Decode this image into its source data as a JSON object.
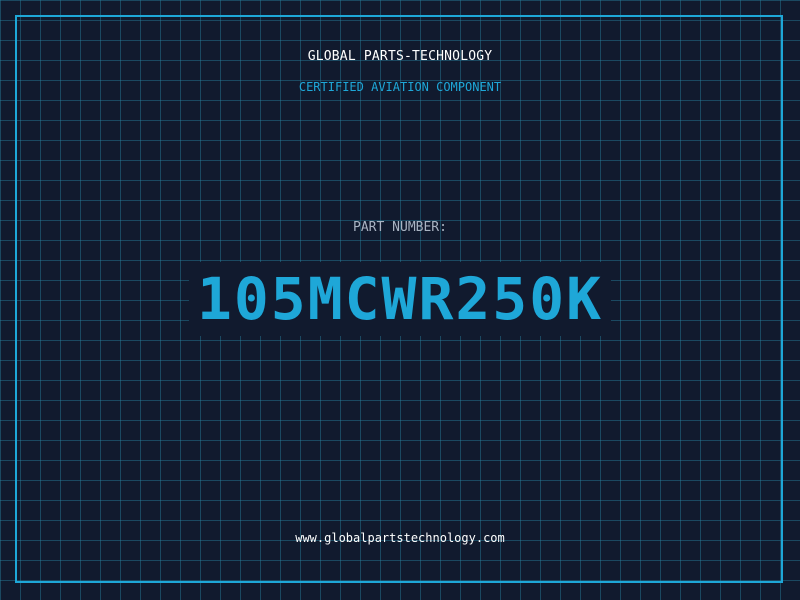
{
  "header": {
    "company": "GLOBAL PARTS-TECHNOLOGY",
    "subtitle": "CERTIFIED AVIATION COMPONENT"
  },
  "part": {
    "label": "PART NUMBER:",
    "number": "105MCWR250K"
  },
  "footer": {
    "website": "www.globalpartstechnology.com"
  },
  "colors": {
    "background": "#111a2e",
    "accent": "#1ea7d8",
    "grid": "#28829f",
    "text": "#ffffff",
    "label": "#a9b3c2"
  }
}
